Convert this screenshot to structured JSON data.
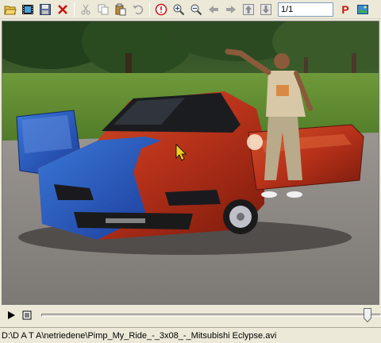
{
  "toolbar": {
    "buttons": [
      {
        "name": "open-folder-icon"
      },
      {
        "name": "filmstrip-icon"
      },
      {
        "name": "save-icon"
      },
      {
        "name": "delete-icon"
      },
      {
        "name": "cut-icon"
      },
      {
        "name": "copy-icon"
      },
      {
        "name": "paste-icon"
      },
      {
        "name": "undo-icon"
      },
      {
        "name": "info-icon"
      },
      {
        "name": "zoom-in-icon"
      },
      {
        "name": "zoom-out-icon"
      },
      {
        "name": "back-arrow-icon"
      },
      {
        "name": "forward-arrow-icon"
      },
      {
        "name": "page-up-icon"
      },
      {
        "name": "page-down-icon"
      }
    ],
    "page_value": "1/1",
    "extra": [
      {
        "name": "p-icon",
        "label": "P"
      },
      {
        "name": "screenshot-icon"
      }
    ],
    "colors": {
      "delete": "#cc1111",
      "info": "#cc1111",
      "p": "#cc1111"
    }
  },
  "playback": {
    "position": 0.96
  },
  "status": {
    "path": "D:\\D A T A\\netriedene\\Pimp_My_Ride_-_3x08_-_Mitsubishi Eclypse.avi"
  }
}
